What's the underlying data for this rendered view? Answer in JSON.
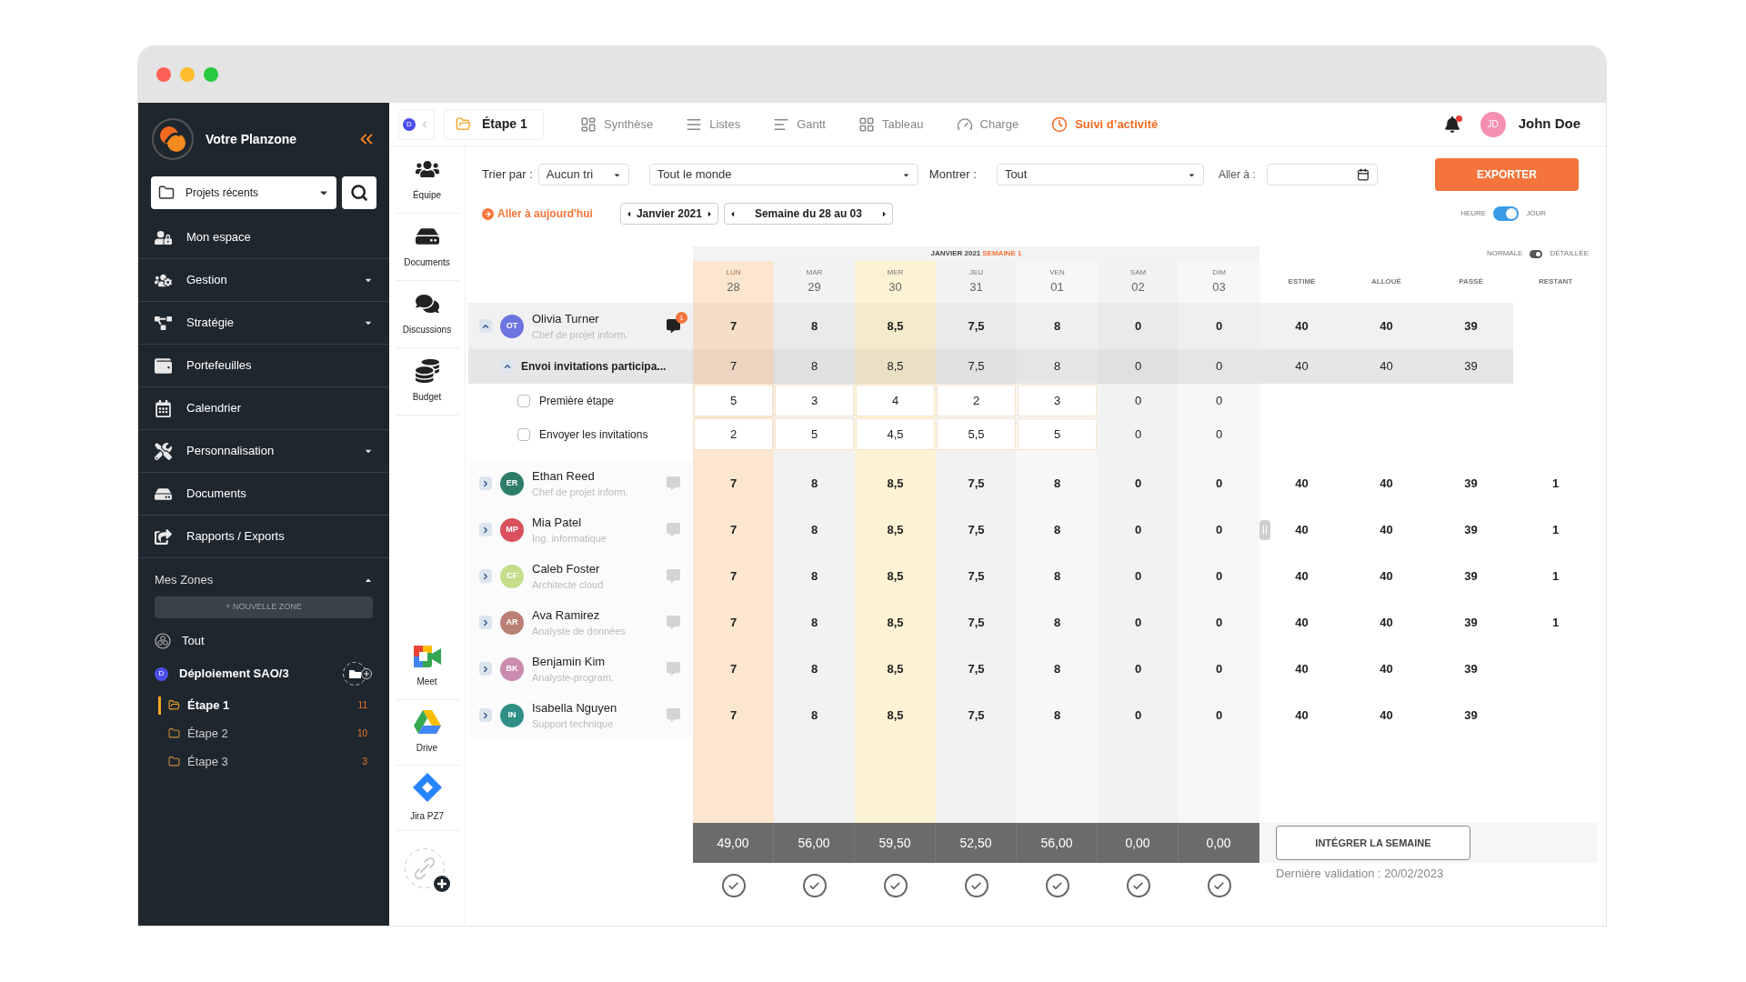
{
  "sidebar": {
    "brand": "Votre Planzone",
    "project_picker": {
      "value": "Projets récents"
    },
    "nav": [
      {
        "label": "Mon espace",
        "has_submenu": false
      },
      {
        "label": "Gestion",
        "has_submenu": true
      },
      {
        "label": "Stratégie",
        "has_submenu": true
      },
      {
        "label": "Portefeuilles",
        "has_submenu": false
      },
      {
        "label": "Calendrier",
        "has_submenu": false
      },
      {
        "label": "Personnalisation",
        "has_submenu": true
      },
      {
        "label": "Documents",
        "has_submenu": false
      },
      {
        "label": "Rapports / Exports",
        "has_submenu": false
      }
    ],
    "zones": {
      "title": "Mes Zones",
      "expanded": true,
      "new_zone": "+ NOUVELLE ZONE",
      "all": "Tout",
      "workspace": {
        "badge": "D",
        "name": "Déploiement SAO/3"
      },
      "folders": [
        {
          "label": "Étape 1",
          "count": "11",
          "selected": true
        },
        {
          "label": "Étape 2",
          "count": "10",
          "selected": false
        },
        {
          "label": "Étape 3",
          "count": "3",
          "selected": false
        }
      ]
    }
  },
  "topbar": {
    "workspace_badge": "D",
    "current": "Étape 1",
    "views": [
      {
        "label": "Synthèse",
        "selected": false
      },
      {
        "label": "Listes",
        "selected": false
      },
      {
        "label": "Gantt",
        "selected": false
      },
      {
        "label": "Tableau",
        "selected": false
      },
      {
        "label": "Charge",
        "selected": false
      },
      {
        "label": "Suivi d’activité",
        "selected": true
      }
    ],
    "notifications": true,
    "user": {
      "initials": "JD",
      "name": "John Doe"
    }
  },
  "tools": [
    {
      "label": "Équipe"
    },
    {
      "label": "Documents"
    },
    {
      "label": "Discussions"
    },
    {
      "label": "Budget"
    }
  ],
  "integrations": [
    {
      "label": "Meet"
    },
    {
      "label": "Drive"
    },
    {
      "label": "Jira PZ7"
    }
  ],
  "filters": {
    "sort_label": "Trier par :",
    "sort_value": "Aucun tri",
    "people_value": "Tout le monde",
    "show_label": "Montrer :",
    "show_value": "Tout",
    "goto_label": "Aller à :",
    "export_button": "EXPORTER"
  },
  "navigation": {
    "today": "Aller à aujourd'hui",
    "month": "Janvier 2021",
    "week": "Semaine du 28 au 03"
  },
  "unit_toggle": {
    "left": "HEURE",
    "right": "JOUR",
    "on": true
  },
  "grid": {
    "month": "JANVIER 2021",
    "week": "SEMAINE 1",
    "view_toggle": {
      "left": "NORMALE",
      "right": "DÉTAILLÉE",
      "on": true
    },
    "days": [
      {
        "dow": "LUN",
        "num": "28",
        "today": true,
        "selected": false
      },
      {
        "dow": "MAR",
        "num": "29",
        "today": false,
        "selected": false
      },
      {
        "dow": "MER",
        "num": "30",
        "today": false,
        "selected": true
      },
      {
        "dow": "JEU",
        "num": "31",
        "today": false,
        "selected": false
      },
      {
        "dow": "VEN",
        "num": "01",
        "today": false,
        "selected": false
      },
      {
        "dow": "SAM",
        "num": "02",
        "today": false,
        "selected": false
      },
      {
        "dow": "DIM",
        "num": "03",
        "today": false,
        "selected": false
      }
    ],
    "summary_columns": [
      "ESTIMÉ",
      "ALLOUÉ",
      "PASSÉ",
      "RESTANT"
    ],
    "people": [
      {
        "initials": "OT",
        "name": "Olivia Turner",
        "role": "Chef de projet inform.",
        "color": "#6c74e0",
        "expanded": true,
        "comments": "1",
        "hours": [
          "7",
          "8",
          "8,5",
          "7,5",
          "8",
          "0",
          "0"
        ],
        "estimated": "40",
        "allocated": "40",
        "spent": "39",
        "tasks": [
          {
            "name": "Envoi invitations participa...",
            "expanded": true,
            "hours": [
              "7",
              "8",
              "8,5",
              "7,5",
              "8",
              "0",
              "0"
            ],
            "estimated": "40",
            "allocated": "40",
            "spent": "39",
            "subtasks": [
              {
                "name": "Première étape",
                "checked": false,
                "hours": [
                  "5",
                  "3",
                  "4",
                  "2",
                  "3",
                  "0",
                  "0"
                ]
              },
              {
                "name": "Envoyer les invitations",
                "checked": false,
                "hours": [
                  "2",
                  "5",
                  "4,5",
                  "5,5",
                  "5",
                  "0",
                  "0"
                ]
              }
            ]
          }
        ]
      },
      {
        "initials": "ER",
        "name": "Ethan Reed",
        "role": "Chef de projet inform.",
        "color": "#2e7d6b",
        "expanded": false,
        "hours": [
          "7",
          "8",
          "8,5",
          "7,5",
          "8",
          "0",
          "0"
        ],
        "estimated": "40",
        "allocated": "40",
        "spent": "39",
        "remaining": "1"
      },
      {
        "initials": "MP",
        "name": "Mia Patel",
        "role": "Ing. informatique",
        "color": "#d9505e",
        "expanded": false,
        "handle": true,
        "hours": [
          "7",
          "8",
          "8,5",
          "7,5",
          "8",
          "0",
          "0"
        ],
        "estimated": "40",
        "allocated": "40",
        "spent": "39",
        "remaining": "1"
      },
      {
        "initials": "CF",
        "name": "Caleb Foster",
        "role": "Architecte cloud",
        "color": "#c6dd8c",
        "expanded": false,
        "hours": [
          "7",
          "8",
          "8,5",
          "7,5",
          "8",
          "0",
          "0"
        ],
        "estimated": "40",
        "allocated": "40",
        "spent": "39",
        "remaining": "1"
      },
      {
        "initials": "AR",
        "name": "Ava Ramirez",
        "role": "Analyste de données",
        "color": "#b98075",
        "expanded": false,
        "hours": [
          "7",
          "8",
          "8,5",
          "7,5",
          "8",
          "0",
          "0"
        ],
        "estimated": "40",
        "allocated": "40",
        "spent": "39",
        "remaining": "1"
      },
      {
        "initials": "BK",
        "name": "Benjamin Kim",
        "role": "Analyste-program.",
        "color": "#c98bb0",
        "expanded": false,
        "hours": [
          "7",
          "8",
          "8,5",
          "7,5",
          "8",
          "0",
          "0"
        ],
        "estimated": "40",
        "allocated": "40",
        "spent": "39"
      },
      {
        "initials": "IN",
        "name": "Isabella Nguyen",
        "role": "Support technique",
        "color": "#2f8f84",
        "expanded": false,
        "hours": [
          "7",
          "8",
          "8,5",
          "7,5",
          "8",
          "0",
          "0"
        ],
        "estimated": "40",
        "allocated": "40",
        "spent": "39"
      }
    ],
    "totals": [
      {
        "value": "49,00",
        "validated": true
      },
      {
        "value": "56,00",
        "validated": true
      },
      {
        "value": "59,50",
        "validated": true
      },
      {
        "value": "52,50",
        "validated": true
      },
      {
        "value": "56,00",
        "validated": true
      },
      {
        "value": "0,00",
        "validated": true
      },
      {
        "value": "0,00",
        "validated": true
      }
    ],
    "integrate_button": "INTÉGRER LA SEMAINE",
    "last_validation": "Dernière validation : 20/02/2023"
  }
}
